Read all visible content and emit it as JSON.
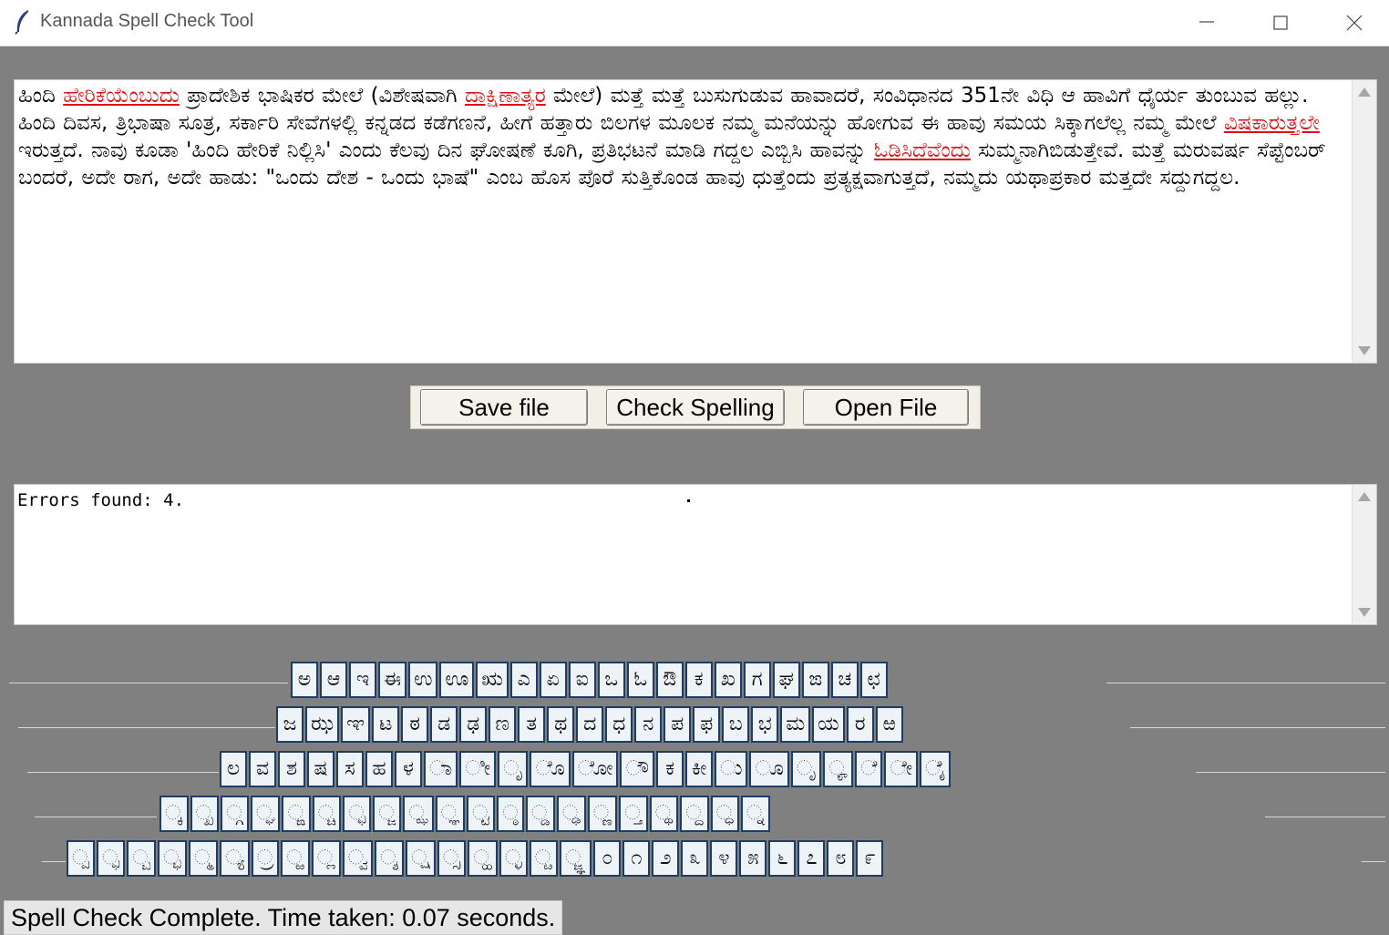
{
  "window": {
    "title": "Kannada Spell Check Tool",
    "icons": {
      "app": "feather-icon",
      "minimize": "minimize-icon",
      "maximize": "maximize-icon",
      "close": "close-icon"
    }
  },
  "editor": {
    "segments": [
      {
        "text": "ಹಿಂದಿ ",
        "error": false
      },
      {
        "text": "ಹೇರಿಕೆಯೆಂಬುದು",
        "error": true
      },
      {
        "text": " ಪ್ರಾದೇಶಿಕ ಭಾಷಿಕರ ಮೇಲೆ (ವಿಶೇಷವಾಗಿ ",
        "error": false
      },
      {
        "text": "ದಾಕ್ಷಿಣಾತ್ಯರ",
        "error": true
      },
      {
        "text": " ಮೇಲೆ) ಮತ್ತೆ ಮತ್ತೆ ಬುಸುಗುಡುವ ಹಾವಾದರೆ, ಸಂವಿಧಾನದ 351ನೇ ವಿಧಿ ಆ ಹಾವಿಗೆ ಧೈರ್ಯ ತುಂಬುವ ಹಲ್ಲು. ಹಿಂದಿ ದಿವಸ, ತ್ರಿಭಾಷಾ ಸೂತ್ರ, ಸರ್ಕಾರಿ ಸೇವೆಗಳಲ್ಲಿ ಕನ್ನಡದ ಕಡೆಗಣನೆ, ಹೀಗೆ ಹತ್ತಾರು ಬಿಲಗಳ ಮೂಲಕ ನಮ್ಮ ಮನೆಯನ್ನು ಹೋಗುವ ಈ ಹಾವು ಸಮಯ ಸಿಕ್ಕಾಗಲೆಲ್ಲ ನಮ್ಮ ಮೇಲೆ ",
        "error": false
      },
      {
        "text": "ವಿಷಕಾರುತ್ತಲೇ",
        "error": true
      },
      {
        "text": " ಇರುತ್ತದೆ. ನಾವು ಕೂಡಾ 'ಹಿಂದಿ ಹೇರಿಕೆ ನಿಲ್ಲಿಸಿ' ಎಂದು ಕೆಲವು ದಿನ ಘೋಷಣೆ ಕೂಗಿ, ಪ್ರತಿಭಟನೆ ಮಾಡಿ ಗದ್ದಲ ಎಬ್ಬಿಸಿ ಹಾವನ್ನು ",
        "error": false
      },
      {
        "text": "ಓಡಿಸಿದೆವೆಂದು",
        "error": true
      },
      {
        "text": " ಸುಮ್ಮನಾಗಿಬಿಡುತ್ತೇವೆ. ಮತ್ತೆ ಮರುವರ್ಷ ಸೆಪ್ಟೆಂಬರ್ ಬಂದರೆ, ಅದೇ ರಾಗ, ಅದೇ ಹಾಡು: \"ಒಂದು ದೇಶ - ಒಂದು ಭಾಷೆ\" ಎಂಬ ಹೊಸ ಪೊರೆ ಸುತ್ತಿಕೊಂಡ ಹಾವು ಧುತ್ತೆಂದು ಪ್ರತ್ಯಕ್ಷವಾಗುತ್ತದೆ, ನಮ್ಮದು ಯಥಾಪ್ರಕಾರ ಮತ್ತದೇ ಸದ್ದುಗದ್ದಲ.",
        "error": false
      }
    ]
  },
  "buttons": {
    "save": "Save file",
    "check": "Check Spelling",
    "open": "Open File"
  },
  "output": {
    "text": "Errors found: 4."
  },
  "keyboard": {
    "rows": [
      [
        "ಅ",
        "ಆ",
        "ಇ",
        "ಈ",
        "ಉ",
        "ಊ",
        "ಋ",
        "ಎ",
        "ಏ",
        "ಐ",
        "ಒ",
        "ಓ",
        "ಔ",
        "ಕ",
        "ಖ",
        "ಗ",
        "ಘ",
        "ಙ",
        "ಚ",
        "ಛ"
      ],
      [
        "ಜ",
        "ಝ",
        "ಞ",
        "ಟ",
        "ಠ",
        "ಡ",
        "ಢ",
        "ಣ",
        "ತ",
        "ಥ",
        "ದ",
        "ಧ",
        "ನ",
        "ಪ",
        "ಫ",
        "ಬ",
        "ಭ",
        "ಮ",
        "ಯ",
        "ರ",
        "ಱ"
      ],
      [
        "ಲ",
        "ವ",
        "ಶ",
        "ಷ",
        "ಸ",
        "ಹ",
        "ಳ",
        "ಾ",
        "ೀ",
        "ೃ",
        "ೊ",
        "ೋ",
        "ೌ",
        "ಕ",
        "ಕೀ",
        "ು",
        "ೂ",
        "ೃ",
        "ೄ",
        "ೆ",
        "ೇ",
        "ೈ"
      ],
      [
        "್ಕ",
        "್ಖ",
        "್ಗ",
        "್ಘ",
        "್ಙ",
        "್ಚ",
        "್ಛ",
        "್ಜ",
        "್ಝ",
        "್ಞ",
        "್ಟ",
        "್ಠ",
        "್ಡ",
        "್ಢ",
        "್ಣ",
        "್ತ",
        "್ಥ",
        "್ದ",
        "್ಧ",
        "್ನ"
      ],
      [
        "್ಪ",
        "್ಫ",
        "್ಬ",
        "್ಭ",
        "್ಮ",
        "್ಯ",
        "್ರ",
        "್ಱ",
        "್ಲ",
        "್ವ",
        "್ಶ",
        "್ಷ",
        "್ಸ",
        "್ಹ",
        "್ಳ",
        "್ೞ",
        "್ಜ್ಞ",
        "೦",
        "೧",
        "೨",
        "೩",
        "೪",
        "೫",
        "೬",
        "೭",
        "೮",
        "೯"
      ]
    ]
  },
  "status": {
    "text": "Spell Check Complete. Time taken: 0.07 seconds."
  }
}
